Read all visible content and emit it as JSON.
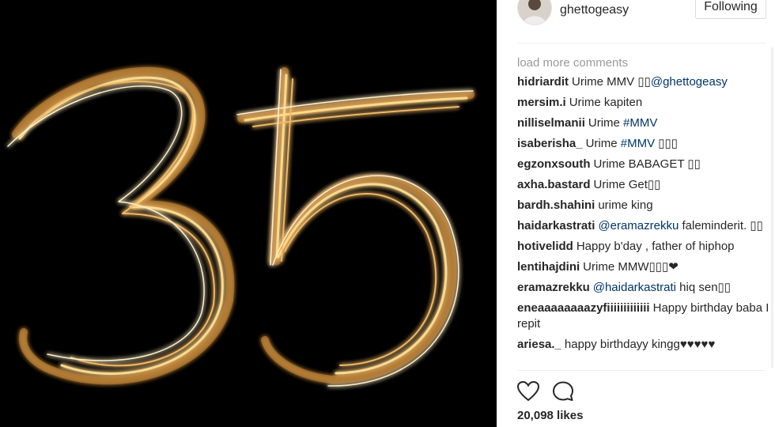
{
  "post": {
    "username": "ghettogeasy",
    "follow_label": "Following"
  },
  "comments": {
    "load_more": "load more comments",
    "items": [
      {
        "author": "hidriardit",
        "parts": [
          {
            "t": "Urime MMV ▯▯"
          },
          {
            "t": "@ghettogeasy",
            "link": true
          }
        ]
      },
      {
        "author": "mersim.i",
        "parts": [
          {
            "t": "Urime kapiten"
          }
        ]
      },
      {
        "author": "nilliselmanii",
        "parts": [
          {
            "t": "Urime "
          },
          {
            "t": "#MMV",
            "link": true
          }
        ]
      },
      {
        "author": "isaberisha_",
        "parts": [
          {
            "t": "Urime "
          },
          {
            "t": "#MMV",
            "link": true
          },
          {
            "t": " ▯▯▯"
          }
        ]
      },
      {
        "author": "egzonxsouth",
        "parts": [
          {
            "t": "Urime BABAGET ▯▯"
          }
        ]
      },
      {
        "author": "axha.bastard",
        "parts": [
          {
            "t": "Urime Get▯▯"
          }
        ]
      },
      {
        "author": "bardh.shahini",
        "parts": [
          {
            "t": "urime king"
          }
        ]
      },
      {
        "author": "haidarkastrati",
        "parts": [
          {
            "t": "@eramazrekku",
            "link": true
          },
          {
            "t": " faleminderit. ▯▯"
          }
        ]
      },
      {
        "author": "hotivelidd",
        "parts": [
          {
            "t": "Happy b'day , father of hiphop"
          }
        ]
      },
      {
        "author": "lentihajdini",
        "parts": [
          {
            "t": "Urime MMW▯▯▯❤"
          }
        ]
      },
      {
        "author": "eramazrekku",
        "parts": [
          {
            "t": "@haidarkastrati",
            "link": true
          },
          {
            "t": " hiq sen▯▯"
          }
        ]
      },
      {
        "author": "eneaaaaaaaazyfiiiiiiiiiiiii",
        "parts": [
          {
            "t": "Happy birthday baba I repit"
          }
        ]
      },
      {
        "author": "ariesa._",
        "parts": [
          {
            "t": "happy birthdayy kingg♥♥♥♥♥"
          }
        ]
      }
    ]
  },
  "actions": {
    "like_icon": "heart-outline-icon",
    "comment_icon": "speech-bubble-icon",
    "likes_text": "20,098 likes"
  },
  "colors": {
    "link": "#003569",
    "glow": "#f3c56a",
    "muted": "#999999"
  }
}
